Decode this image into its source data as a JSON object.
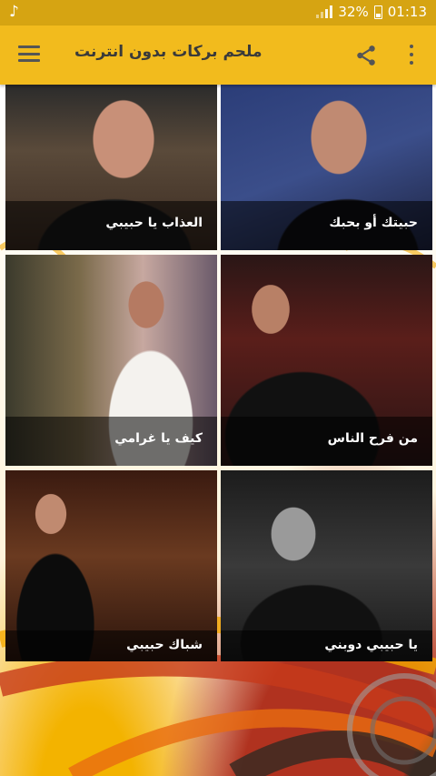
{
  "status_bar": {
    "music_icon": "music-note-icon",
    "battery_level": "32%",
    "time": "01:13"
  },
  "app_bar": {
    "title": "ملحم بركات بدون انترنت",
    "menu_icon": "hamburger-menu-icon",
    "share_icon": "share-icon",
    "more_icon": "more-vertical-icon",
    "background_color": "#f2bb1d"
  },
  "songs": [
    {
      "title": "العذاب يا حبيبي"
    },
    {
      "title": "حبيتك أو بحبك"
    },
    {
      "title": "كيف يا غرامي"
    },
    {
      "title": "من فرح الناس"
    },
    {
      "title": "شباك حبيبي"
    },
    {
      "title": "يا حبيبي دوبني"
    }
  ]
}
